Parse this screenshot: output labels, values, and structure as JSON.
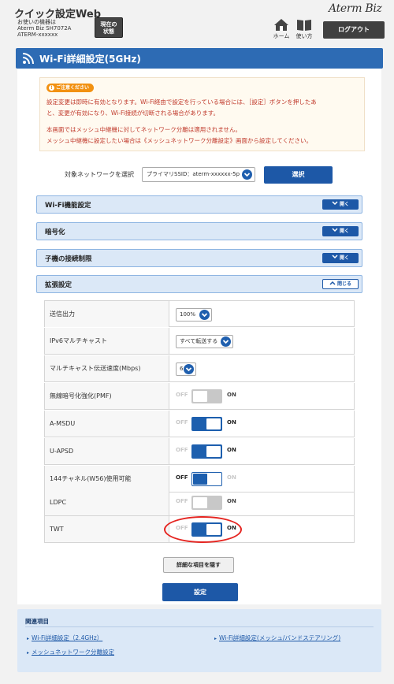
{
  "header": {
    "app_title": "クイック設定Web",
    "device_lines": [
      "お使いの機器は",
      "Aterm Biz SH7072A",
      "ATERM-xxxxxx"
    ],
    "status_button_lines": [
      "現在の",
      "状態"
    ],
    "brand": "Aterm Biz",
    "home_label": "ホーム",
    "howto_label": "使い方",
    "logout_label": "ログアウト"
  },
  "page": {
    "title": "Wi-Fi詳細設定(5GHz)"
  },
  "notice": {
    "tag": "ご注意ください",
    "lines": [
      "設定変更は即時に有効となります。Wi-Fi経由で設定を行っている場合には、［設定］ボタンを押したあ",
      "と、変更が有効になり、Wi-Fi接続が切断される場合があります。",
      "本画面ではメッシュ中継機に対してネットワーク分離は適用されません。",
      "メッシュ中継機に設定したい場合は《メッシュネットワーク分離設定》画面から設定してください。"
    ]
  },
  "network": {
    "label": "対象ネットワークを選択",
    "selected": "プライマリSSID：aterm-xxxxxx-5p",
    "select_button": "選択"
  },
  "sections": [
    {
      "label": "Wi-Fi機能設定",
      "toggle": "開く"
    },
    {
      "label": "暗号化",
      "toggle": "開く"
    },
    {
      "label": "子機の接続制限",
      "toggle": "開く"
    },
    {
      "label": "拡張設定",
      "toggle": "閉じる"
    }
  ],
  "settings": {
    "on_label": "ON",
    "off_label": "OFF",
    "tx_power": {
      "label": "送信出力",
      "value": "100%"
    },
    "ipv6_multicast": {
      "label": "IPv6マルチキャスト",
      "value": "すべて転送する"
    },
    "multicast_rate": {
      "label": "マルチキャスト伝送速度(Mbps)",
      "value": "6"
    },
    "pmf": {
      "label": "無線暗号化強化(PMF)",
      "state": "disabled"
    },
    "amsdu": {
      "label": "A-MSDU",
      "state": "on"
    },
    "uapsd": {
      "label": "U-APSD",
      "state": "on"
    },
    "ch144": {
      "label": "144チャネル(W56)使用可能",
      "state": "off"
    },
    "ldpc": {
      "label": "LDPC",
      "state": "disabled"
    },
    "twt": {
      "label": "TWT",
      "state": "on"
    }
  },
  "buttons": {
    "hide_details": "詳細な項目を隠す",
    "apply": "設定"
  },
  "related": {
    "title": "関連項目",
    "links": [
      "Wi-Fi詳細設定（2.4GHz）",
      "Wi-Fi詳細設定(メッシュ/バンドステアリング)",
      "メッシュネットワーク分離設定"
    ]
  },
  "colors": {
    "primary": "#1d58a7",
    "title_bar": "#2d6bb4",
    "switch_on": "#1d5fae",
    "switch_disabled": "#c8c8c8",
    "notice_text": "#c0392b",
    "highlight": "#e52521"
  }
}
